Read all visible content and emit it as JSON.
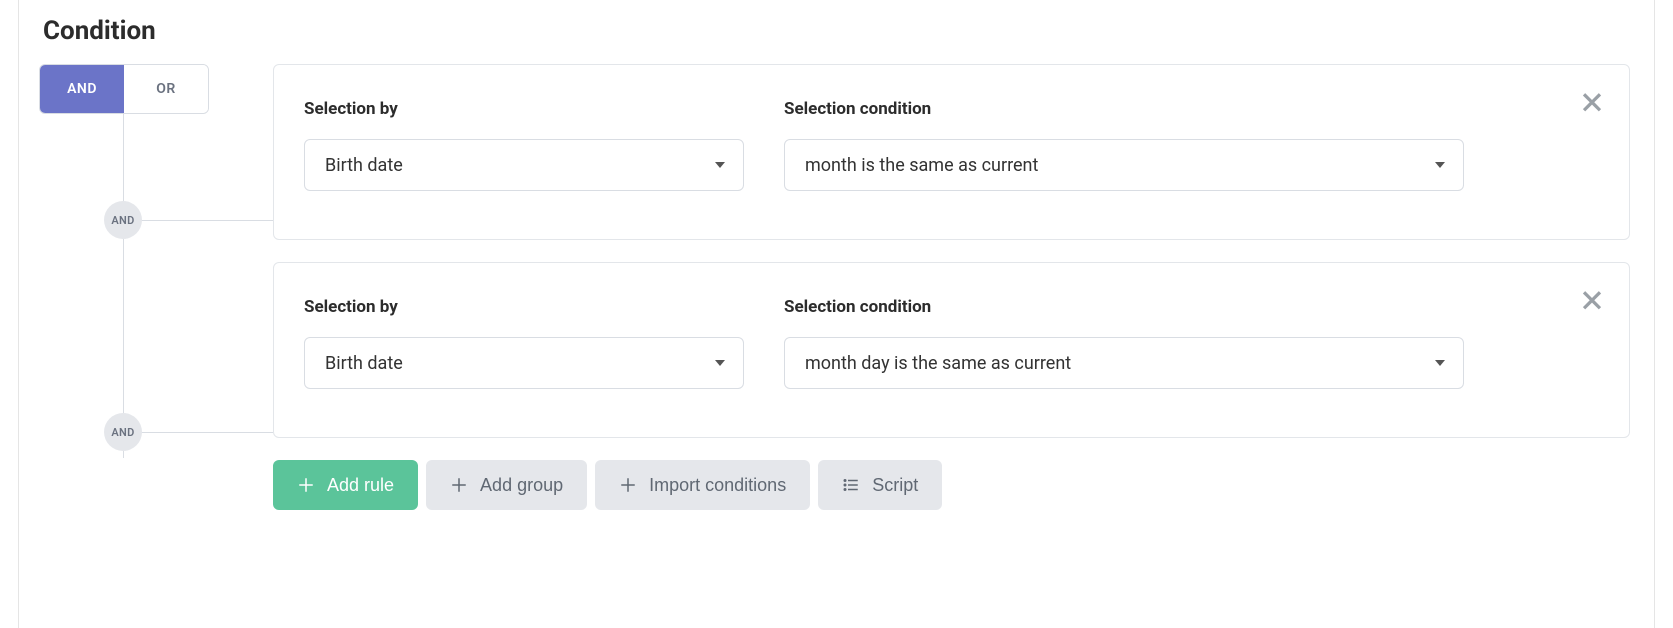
{
  "heading": "Condition",
  "toggle": {
    "and": "AND",
    "or": "OR",
    "active": "AND"
  },
  "node_badge": "AND",
  "labels": {
    "selection_by": "Selection by",
    "selection_condition": "Selection condition"
  },
  "rules": [
    {
      "by": "Birth date",
      "cond": "month is the same as current"
    },
    {
      "by": "Birth date",
      "cond": "month day is the same as current"
    }
  ],
  "actions": {
    "add_rule": "Add rule",
    "add_group": "Add group",
    "import_conditions": "Import conditions",
    "script": "Script"
  }
}
